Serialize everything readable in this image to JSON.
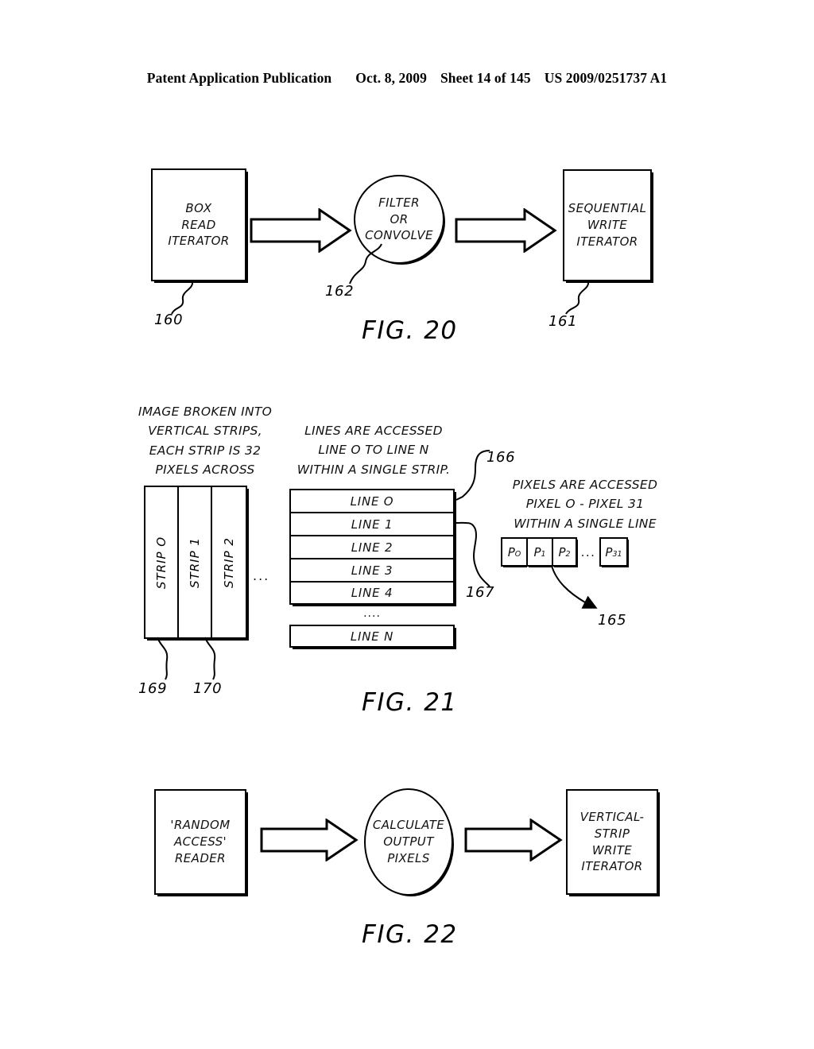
{
  "header": {
    "publication": "Patent Application Publication",
    "date": "Oct. 8, 2009",
    "sheet": "Sheet 14 of 145",
    "docnum": "US 2009/0251737 A1"
  },
  "fig20": {
    "label": "FIG. 20",
    "source_box": {
      "lines": [
        "BOX",
        "READ",
        "ITERATOR"
      ],
      "ref": "160"
    },
    "process_circle": {
      "lines": [
        "FILTER",
        "OR",
        "CONVOLVE"
      ],
      "ref": "162"
    },
    "dest_box": {
      "lines": [
        "SEQUENTIAL",
        "WRITE",
        "ITERATOR"
      ],
      "ref": "161"
    }
  },
  "fig21": {
    "label": "FIG. 21",
    "strip_caption": [
      "IMAGE BROKEN INTO",
      "VERTICAL STRIPS,",
      "EACH STRIP IS 32",
      "PIXELS ACROSS"
    ],
    "line_caption": [
      "LINES ARE ACCESSED",
      "LINE O TO LINE N",
      "WITHIN A SINGLE STRIP."
    ],
    "pixel_caption": [
      "PIXELS ARE ACCESSED",
      "PIXEL O - PIXEL 31",
      "WITHIN A SINGLE LINE"
    ],
    "strips": [
      "STRIP O",
      "STRIP 1",
      "STRIP 2"
    ],
    "strips_ellipsis": "...",
    "strip_refs": [
      "169",
      "170"
    ],
    "lines": [
      "LINE O",
      "LINE 1",
      "LINE 2",
      "LINE 3",
      "LINE 4"
    ],
    "lines_ellipsis": "....",
    "line_last": "LINE N",
    "line_refs": {
      "top": "166",
      "bracket": "167"
    },
    "pixels": [
      {
        "name": "P",
        "index": "O"
      },
      {
        "name": "P",
        "index": "1"
      },
      {
        "name": "P",
        "index": "2"
      }
    ],
    "pixels_ellipsis": "...",
    "pixel_last": {
      "name": "P",
      "index": "31"
    },
    "pixel_ref": "165"
  },
  "fig22": {
    "label": "FIG. 22",
    "source_box": {
      "lines": [
        "'RANDOM",
        "ACCESS'",
        "READER"
      ]
    },
    "process_circle": {
      "lines": [
        "CALCULATE",
        "OUTPUT",
        "PIXELS"
      ]
    },
    "dest_box": {
      "lines": [
        "VERTICAL-",
        "STRIP",
        "WRITE",
        "ITERATOR"
      ]
    }
  },
  "colors": {
    "ink": "#000000",
    "paper": "#ffffff"
  }
}
